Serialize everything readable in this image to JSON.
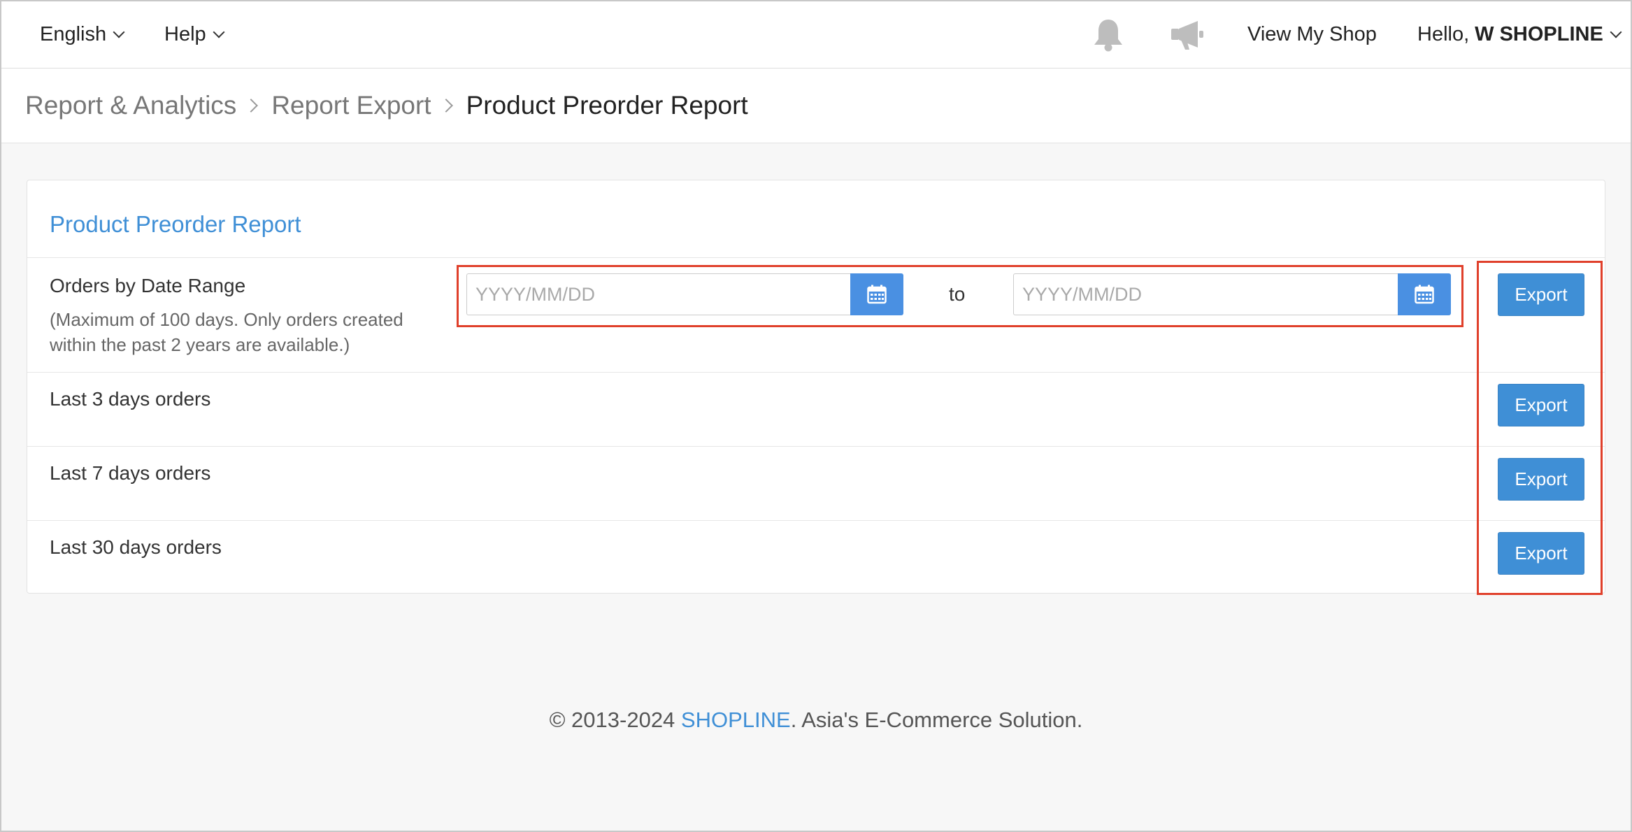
{
  "topbar": {
    "language_label": "English",
    "help_label": "Help",
    "view_shop_label": "View My Shop",
    "greeting": "Hello,",
    "user_name": "W SHOPLINE",
    "notification_icon": "bell-icon",
    "announcement_icon": "megaphone-icon"
  },
  "breadcrumb": {
    "items": [
      "Report & Analytics",
      "Report Export"
    ],
    "current": "Product Preorder Report"
  },
  "panel": {
    "title": "Product Preorder Report",
    "date_range": {
      "label": "Orders by Date Range",
      "note": "(Maximum of 100 days. Only orders created within the past 2 years are available.)",
      "start_placeholder": "YYYY/MM/DD",
      "end_placeholder": "YYYY/MM/DD",
      "separator": "to",
      "calendar_icon": "calendar-icon"
    },
    "rows": [
      {
        "label": "Last 3 days orders"
      },
      {
        "label": "Last 7 days orders"
      },
      {
        "label": "Last 30 days orders"
      }
    ],
    "export_label": "Export"
  },
  "footer": {
    "prefix": "© 2013-2024 ",
    "brand": "SHOPLINE",
    "suffix": ". Asia's E-Commerce Solution."
  },
  "colors": {
    "accent": "#3f8fd6",
    "highlight": "#e0402b",
    "background": "#f7f7f7"
  }
}
